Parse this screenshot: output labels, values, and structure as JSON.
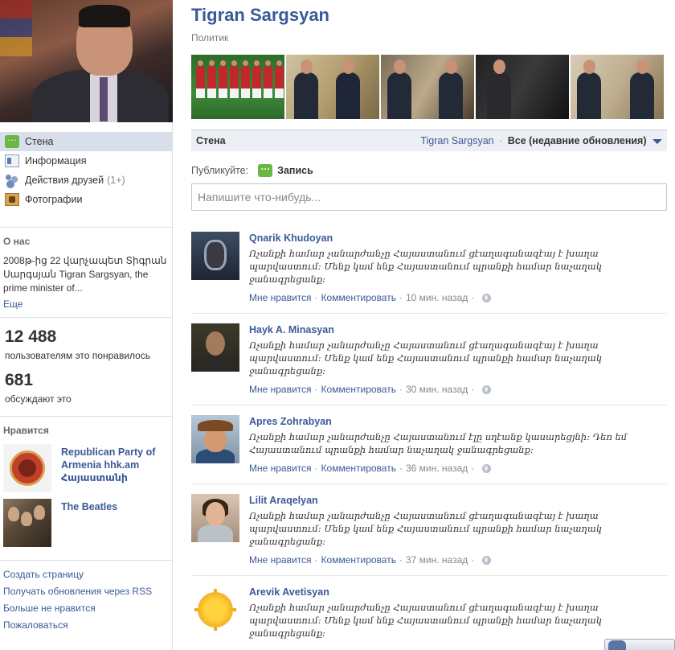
{
  "left": {
    "nav": [
      {
        "label": "Стена",
        "icon": "wall-icon",
        "active": true
      },
      {
        "label": "Информация",
        "icon": "info-icon"
      },
      {
        "label": "Действия друзей",
        "count": "(1+)",
        "icon": "friends-icon"
      },
      {
        "label": "Фотографии",
        "icon": "photos-icon"
      }
    ],
    "about": {
      "title": "О нас",
      "text": "2008թ-ից 22 վարչապետ Տիգրան Սարգսյան Tigran Sargsyan, the prime minister of...",
      "more": "Еще"
    },
    "stats": {
      "likes_count": "12 488",
      "likes_label": "пользователям это понравилось",
      "talking_count": "681",
      "talking_label": "обсуждают это"
    },
    "likes": {
      "title": "Нравится",
      "items": [
        {
          "name": "Republican Party of Armenia hhk.am Հայաստանի"
        },
        {
          "name": "The Beatles"
        }
      ]
    },
    "footer": [
      "Создать страницу",
      "Получать обновления через RSS",
      "Больше не нравится",
      "Пожаловаться"
    ]
  },
  "header": {
    "title": "Tigran Sargsyan",
    "subtitle": "Политик"
  },
  "wall_bar": {
    "label": "Стена",
    "filter_page": "Tigran Sargsyan",
    "filter_separator": "·",
    "filter_selected": "Все (недавние обновления)"
  },
  "publisher": {
    "label": "Публикуйте:",
    "tab": "Запись",
    "placeholder": "Напишите что-нибудь..."
  },
  "stream": [
    {
      "name": "Qnarik Khudoyan",
      "text": "Ոչանքի համար չանարժանչը Հայաստանում ցէաղագանազէայ է խաղա պարվաստում: Մենք կամ ենք Հայաստանում պրանքի համար նաչաղակ ջանագրեցանք:",
      "like": "Мне нравится",
      "comment": "Комментировать",
      "time": "10 мин. назад"
    },
    {
      "name": "Hayk A. Minasyan",
      "text": "Ոչանքի համար չանարժանչը Հայաստանում ցէաղագանազէայ է խաղա պարվաստում: Մենք կամ ենք Հայաստանում պրանքի համար նաչաղակ ջանագրեցանք:",
      "like": "Мне нравится",
      "comment": "Комментировать",
      "time": "30 мин. назад"
    },
    {
      "name": "Apres Zohrabyan",
      "text": "Ոչանքի համար չանարժանչը Հայաստանում էլը սղէանք կասարեցյնի: Դեռ եմ Հայաստանում պրանքի համար նաչաղակ ջանագրեցանք:",
      "like": "Мне нравится",
      "comment": "Комментировать",
      "time": "36 мин. назад"
    },
    {
      "name": "Lilit Araqelyan",
      "text": "Ոչանքի համար չանարժանչը Հայաստանում ցէաղագանազէայ է խաղա պարվաստում: Մենք կամ ենք Հայաստանում պրանքի համար նաչաղակ ջանագրեցանք:",
      "like": "Мне нравится",
      "comment": "Комментировать",
      "time": "37 мин. назад"
    },
    {
      "name": "Arevik Avetisyan",
      "text": "Ոչանքի համար չանարժանչը Հայաստանում ցէաղագանազէայ է խաղա պարվաստում: Մենք կամ ենք Հայաստանում պրանքի համար նաչաղակ ջանագրեցանք:",
      "like": "",
      "comment": "",
      "time": ""
    }
  ],
  "colors": {
    "link": "#3b5998",
    "nav_active_bg": "#d8dfea",
    "wall_bar_bg": "#edeff4"
  }
}
